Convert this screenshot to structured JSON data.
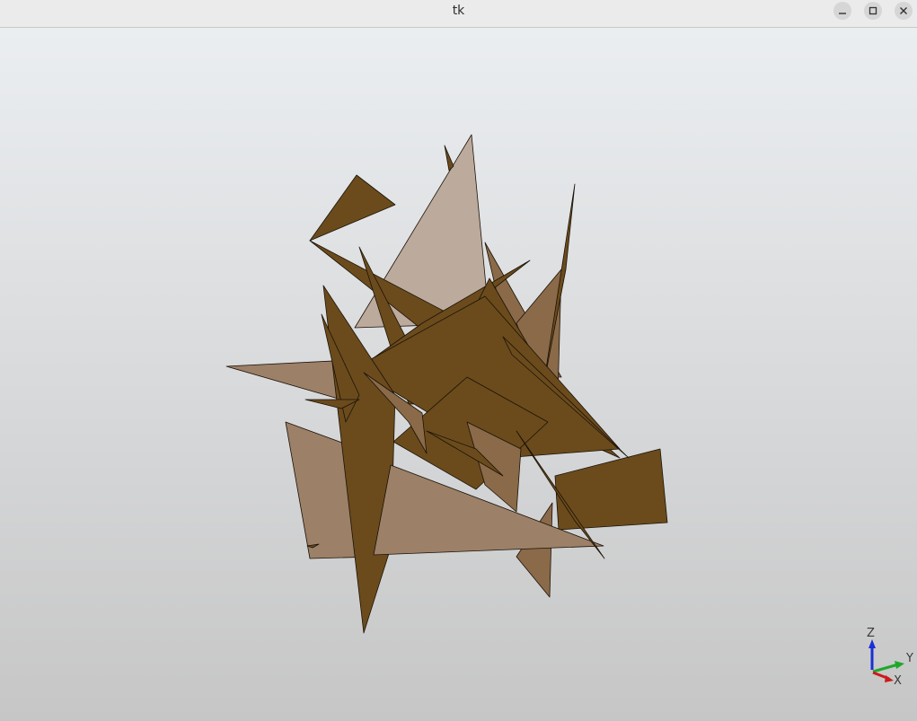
{
  "window": {
    "title": "tk",
    "controls": {
      "minimize_icon": "minimize-icon",
      "maximize_icon": "maximize-icon",
      "close_icon": "close-icon"
    }
  },
  "viewport": {
    "background_top": "#ebeef1",
    "background_bottom": "#c6c6c6",
    "shape_colors": {
      "dark": "#6b4b1c",
      "mid": "#8a6a48",
      "light": "#9c8068",
      "pale": "#bcaa9c",
      "edge": "#1a1208"
    }
  },
  "axes_triad": {
    "z_label": "Z",
    "y_label": "Y",
    "x_label": "X",
    "z_color": "#1a2fd6",
    "y_color": "#1ea82a",
    "x_color": "#cc1a1a"
  }
}
